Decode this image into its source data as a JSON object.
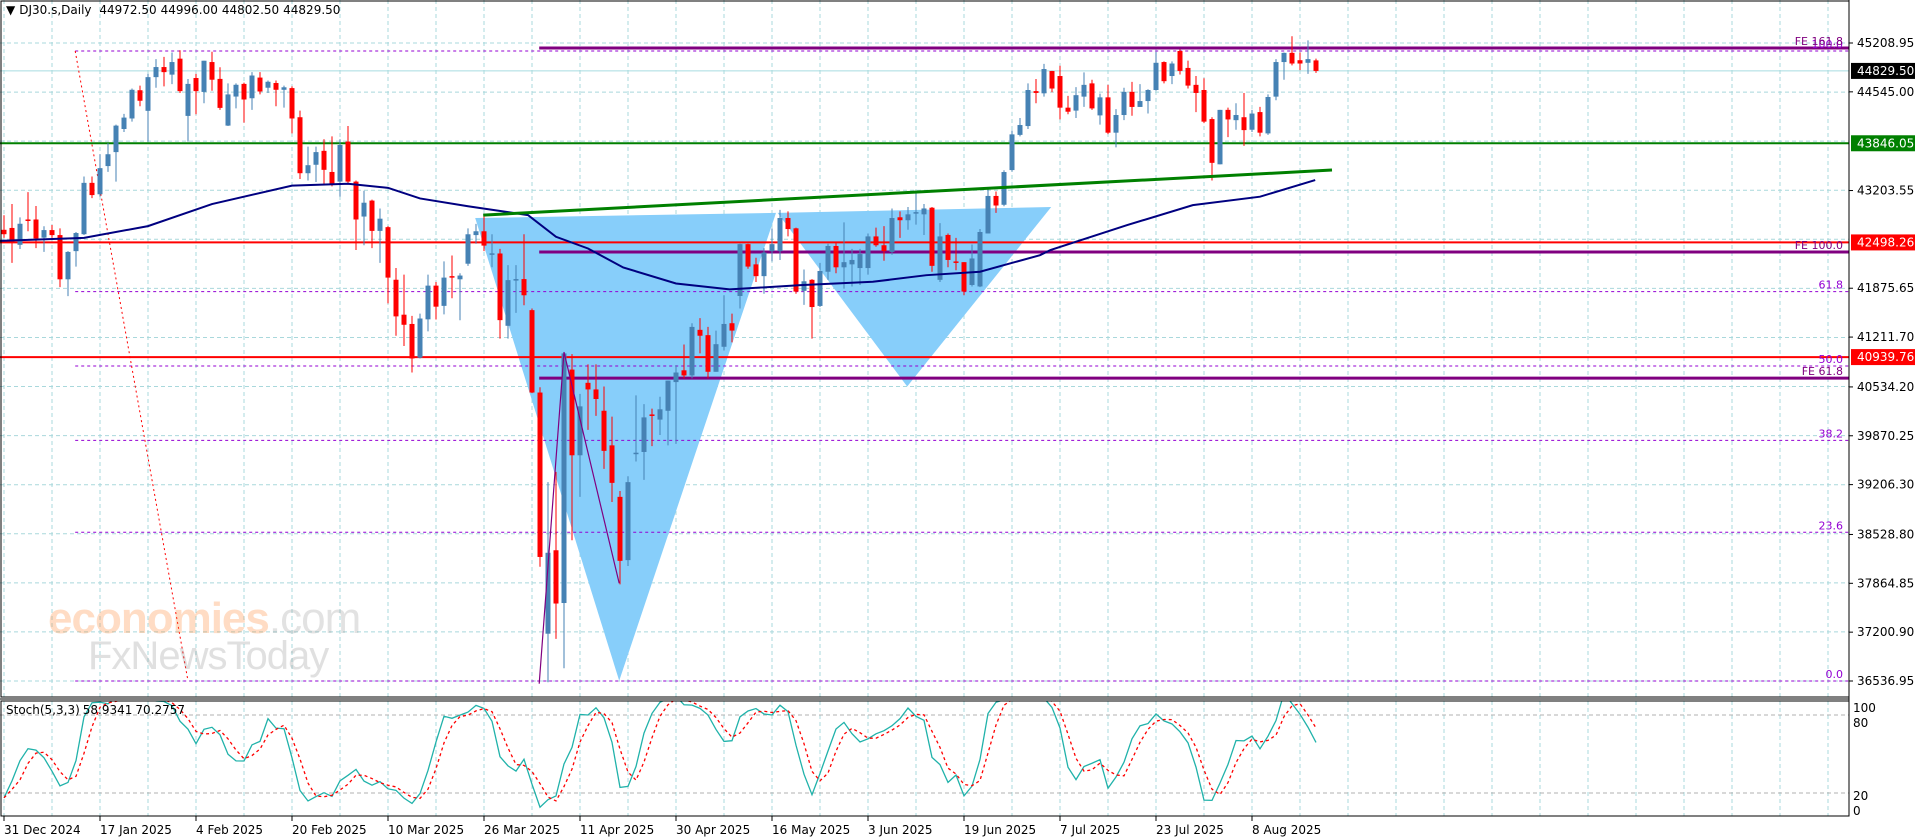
{
  "header": {
    "symbol": "DJ30.s,Daily",
    "open": "44972.50",
    "high": "44996.00",
    "low": "44802.50",
    "close": "44829.50"
  },
  "stoch_header": {
    "name": "Stoch(5,3,3)",
    "main": "58.9341",
    "signal": "70.2757"
  },
  "watermark": {
    "brand1": "economies",
    "brand1_suffix": ".com",
    "brand2": "FxNewsToday"
  },
  "colors": {
    "bull": "#4682B4",
    "bear": "#FF0000",
    "ma": "#000080",
    "grid": "#A9D8DC",
    "triangle": "#87CEFA",
    "fe": "#800080",
    "fib": "#9400D3",
    "trend": "#008000",
    "stoch_main": "#20B2AA",
    "stoch_signal": "#FF0000"
  },
  "chart_data": {
    "type": "candlestick",
    "title": "DJ30.s,Daily",
    "price_axis": {
      "min": 36536.95,
      "max": 45208.95,
      "ticks": [
        "45208.95",
        "44545.00",
        "43203.55",
        "41875.65",
        "41211.70",
        "40534.20",
        "39870.25",
        "39206.30",
        "38528.80",
        "37864.85",
        "37200.90",
        "36536.95"
      ]
    },
    "x_ticks": [
      {
        "label": "31 Dec 2024",
        "index": 0
      },
      {
        "label": "17 Jan 2025",
        "index": 12
      },
      {
        "label": "4 Feb 2025",
        "index": 24
      },
      {
        "label": "20 Feb 2025",
        "index": 36
      },
      {
        "label": "10 Mar 2025",
        "index": 48
      },
      {
        "label": "26 Mar 2025",
        "index": 60
      },
      {
        "label": "11 Apr 2025",
        "index": 72
      },
      {
        "label": "30 Apr 2025",
        "index": 84
      },
      {
        "label": "16 May 2025",
        "index": 96
      },
      {
        "label": "3 Jun 2025",
        "index": 108
      },
      {
        "label": "19 Jun 2025",
        "index": 120
      },
      {
        "label": "7 Jul 2025",
        "index": 132
      },
      {
        "label": "23 Jul 2025",
        "index": 144
      },
      {
        "label": "8 Aug 2025",
        "index": 156
      }
    ],
    "ohlc": [
      [
        42670,
        42867,
        42560,
        42610
      ],
      [
        42695,
        43021,
        42220,
        42495
      ],
      [
        42466,
        42838,
        42409,
        42752
      ],
      [
        42810,
        43182,
        42650,
        42800
      ],
      [
        42810,
        42993,
        42420,
        42552
      ],
      [
        42563,
        42718,
        42370,
        42666
      ],
      [
        42666,
        42735,
        42560,
        42598
      ],
      [
        42598,
        42690,
        41890,
        41997
      ],
      [
        41997,
        42380,
        41768,
        42369
      ],
      [
        42380,
        42640,
        42170,
        42626
      ],
      [
        42610,
        43394,
        42600,
        43308
      ],
      [
        43308,
        43394,
        43100,
        43142
      ],
      [
        43153,
        43697,
        43120,
        43508
      ],
      [
        43536,
        43850,
        43457,
        43697
      ],
      [
        43726,
        44100,
        43325,
        44086
      ],
      [
        44040,
        44245,
        44000,
        44195
      ],
      [
        44183,
        44590,
        44140,
        44573
      ],
      [
        44567,
        44630,
        44350,
        44424
      ],
      [
        44287,
        44790,
        43869,
        44745
      ],
      [
        44745,
        44990,
        44600,
        44882
      ],
      [
        44882,
        45020,
        44620,
        44813
      ],
      [
        44779,
        45080,
        44650,
        44950
      ],
      [
        44996,
        45110,
        44530,
        44555
      ],
      [
        44218,
        44720,
        43869,
        44653
      ],
      [
        44733,
        44790,
        44240,
        44555
      ],
      [
        44544,
        44968,
        44390,
        44968
      ],
      [
        44950,
        45090,
        44560,
        44710
      ],
      [
        44721,
        44880,
        44300,
        44327
      ],
      [
        44086,
        44660,
        44080,
        44510
      ],
      [
        44481,
        44660,
        44320,
        44641
      ],
      [
        44653,
        44670,
        44126,
        44441
      ],
      [
        44458,
        44813,
        44300,
        44767
      ],
      [
        44739,
        44813,
        44510,
        44550
      ],
      [
        44601,
        44700,
        44530,
        44682
      ],
      [
        44665,
        44700,
        44350,
        44573
      ],
      [
        44573,
        44630,
        44330,
        44607
      ],
      [
        44596,
        44620,
        43980,
        44183
      ],
      [
        44200,
        44290,
        43360,
        43439
      ],
      [
        43439,
        43800,
        43340,
        43548
      ],
      [
        43554,
        43800,
        43320,
        43726
      ],
      [
        43743,
        43900,
        43290,
        43485
      ],
      [
        43456,
        43940,
        43260,
        43296
      ],
      [
        43325,
        43900,
        43120,
        43823
      ],
      [
        43869,
        44080,
        43290,
        43325
      ],
      [
        43325,
        43340,
        42396,
        42810
      ],
      [
        42850,
        43200,
        42460,
        43038
      ],
      [
        43067,
        43080,
        42420,
        42655
      ],
      [
        42655,
        42960,
        42220,
        42821
      ],
      [
        42706,
        42720,
        41670,
        42020
      ],
      [
        41991,
        42150,
        41230,
        41493
      ],
      [
        41516,
        42060,
        41090,
        41379
      ],
      [
        41390,
        41500,
        40730,
        40921
      ],
      [
        40932,
        41530,
        40920,
        41464
      ],
      [
        41453,
        42060,
        41290,
        41911
      ],
      [
        41911,
        41960,
        41450,
        41625
      ],
      [
        41636,
        42240,
        41520,
        42020
      ],
      [
        42040,
        42320,
        41740,
        42020
      ],
      [
        41997,
        42080,
        41440,
        42048
      ],
      [
        42209,
        42690,
        42180,
        42609
      ],
      [
        42598,
        42750,
        42480,
        42650
      ],
      [
        42650,
        42870,
        42380,
        42455
      ],
      [
        42340,
        42610,
        42160,
        42350
      ],
      [
        42348,
        42410,
        41190,
        41442
      ],
      [
        41365,
        42190,
        41190,
        41986
      ],
      [
        41990,
        42190,
        41540,
        42000
      ],
      [
        42000,
        42610,
        41645,
        41780
      ],
      [
        41578,
        41600,
        40450,
        40458
      ],
      [
        40458,
        40530,
        38090,
        38223
      ],
      [
        37180,
        39240,
        36520,
        38280
      ],
      [
        38314,
        39380,
        37110,
        37590
      ],
      [
        37597,
        41010,
        36710,
        40990
      ],
      [
        40770,
        40980,
        38450,
        39605
      ],
      [
        39605,
        40440,
        39040,
        40270
      ],
      [
        40590,
        40840,
        39950,
        40500
      ],
      [
        40500,
        40840,
        40140,
        40370
      ],
      [
        40210,
        40540,
        39420,
        39665
      ],
      [
        39740,
        40130,
        38970,
        39230
      ],
      [
        39040,
        39120,
        37850,
        38170
      ],
      [
        38180,
        39320,
        38100,
        39240
      ],
      [
        39630,
        40420,
        39520,
        39640
      ],
      [
        39650,
        40300,
        39270,
        40120
      ],
      [
        40160,
        40240,
        39730,
        40150
      ],
      [
        40090,
        40400,
        39880,
        40230
      ],
      [
        40210,
        40620,
        39740,
        40620
      ],
      [
        40600,
        40830,
        39760,
        40730
      ],
      [
        40760,
        41110,
        40650,
        40690
      ],
      [
        40690,
        41400,
        40650,
        41350
      ],
      [
        41310,
        41470,
        40990,
        41230
      ],
      [
        41238,
        41350,
        40650,
        40740
      ],
      [
        40740,
        41300,
        40740,
        41115
      ],
      [
        41080,
        41780,
        41030,
        41390
      ],
      [
        41400,
        41530,
        41140,
        41300
      ],
      [
        41770,
        42480,
        41600,
        42475
      ],
      [
        42475,
        42480,
        42140,
        42170
      ],
      [
        42200,
        42290,
        41960,
        42040
      ],
      [
        42040,
        42420,
        41800,
        42360
      ],
      [
        42380,
        42690,
        42240,
        42475
      ],
      [
        42380,
        42940,
        42260,
        42830
      ],
      [
        42830,
        42920,
        42580,
        42680
      ],
      [
        42690,
        42700,
        41800,
        41830
      ],
      [
        41840,
        42130,
        41650,
        41970
      ],
      [
        41990,
        42000,
        41190,
        41620
      ],
      [
        41635,
        42220,
        41620,
        42110
      ],
      [
        42100,
        42480,
        41990,
        42450
      ],
      [
        42450,
        42500,
        42080,
        42160
      ],
      [
        42160,
        42770,
        41870,
        42230
      ],
      [
        42200,
        42410,
        41900,
        42260
      ],
      [
        42150,
        42410,
        41920,
        42340
      ],
      [
        42150,
        42620,
        42060,
        42580
      ],
      [
        42580,
        42700,
        42440,
        42460
      ],
      [
        42460,
        42720,
        42250,
        42380
      ],
      [
        42370,
        42960,
        42330,
        42830
      ],
      [
        42840,
        42920,
        42560,
        42800
      ],
      [
        42800,
        42980,
        42670,
        42880
      ],
      [
        42890,
        43190,
        42740,
        42910
      ],
      [
        42880,
        43020,
        42600,
        42960
      ],
      [
        42970,
        42980,
        42100,
        42180
      ],
      [
        41990,
        42760,
        41960,
        42580
      ],
      [
        42600,
        42620,
        42160,
        42260
      ],
      [
        42240,
        42560,
        42120,
        42230
      ],
      [
        42230,
        42230,
        41780,
        41830
      ],
      [
        41920,
        42470,
        41900,
        42280
      ],
      [
        41900,
        42680,
        41890,
        42640
      ],
      [
        42620,
        43240,
        42620,
        43130
      ],
      [
        43130,
        43190,
        42900,
        43000
      ],
      [
        43010,
        43480,
        42990,
        43455
      ],
      [
        43482,
        44020,
        43460,
        43967
      ],
      [
        43960,
        44190,
        43940,
        44094
      ],
      [
        44080,
        44660,
        44040,
        44570
      ],
      [
        44555,
        44720,
        44390,
        44530
      ],
      [
        44525,
        44925,
        44480,
        44855
      ],
      [
        44828,
        44830,
        44540,
        44590
      ],
      [
        44760,
        44900,
        44170,
        44330
      ],
      [
        44330,
        44490,
        44240,
        44275
      ],
      [
        44290,
        44610,
        44190,
        44500
      ],
      [
        44480,
        44810,
        44340,
        44640
      ],
      [
        44660,
        44710,
        44300,
        44320
      ],
      [
        44225,
        44520,
        44100,
        44470
      ],
      [
        44470,
        44640,
        43970,
        43990
      ],
      [
        43990,
        44310,
        43790,
        44230
      ],
      [
        44230,
        44600,
        44160,
        44545
      ],
      [
        44545,
        44680,
        44220,
        44340
      ],
      [
        44340,
        44650,
        44340,
        44420
      ],
      [
        44420,
        44580,
        44250,
        44570
      ],
      [
        44570,
        45090,
        44560,
        44940
      ],
      [
        44950,
        44960,
        44660,
        44690
      ],
      [
        44760,
        44960,
        44650,
        44930
      ],
      [
        45100,
        45120,
        44780,
        44830
      ],
      [
        44870,
        44970,
        44590,
        44630
      ],
      [
        44640,
        44760,
        44270,
        44530
      ],
      [
        44570,
        44730,
        44120,
        44140
      ],
      [
        44175,
        44200,
        43340,
        43580
      ],
      [
        43560,
        44300,
        43560,
        44300
      ],
      [
        44300,
        44330,
        43930,
        44170
      ],
      [
        44160,
        44390,
        44030,
        44230
      ],
      [
        44200,
        44530,
        43810,
        44025
      ],
      [
        44030,
        44300,
        44000,
        44250
      ],
      [
        44270,
        44340,
        43940,
        43990
      ],
      [
        43980,
        44510,
        43960,
        44475
      ],
      [
        44480,
        44990,
        44430,
        44950
      ],
      [
        44950,
        45080,
        44710,
        45075
      ],
      [
        45075,
        45300,
        44905,
        44930
      ],
      [
        44975,
        45080,
        44840,
        44930
      ],
      [
        44940,
        45245,
        44790,
        44990
      ],
      [
        44972.5,
        44996,
        44802.5,
        44829.5
      ]
    ],
    "moving_average": [
      [
        -0.5,
        42520
      ],
      [
        10,
        42560
      ],
      [
        18,
        42720
      ],
      [
        26,
        43020
      ],
      [
        36,
        43270
      ],
      [
        43,
        43295
      ],
      [
        48,
        43240
      ],
      [
        52,
        43096
      ],
      [
        58,
        42990
      ],
      [
        63,
        42910
      ],
      [
        65.5,
        42870
      ],
      [
        69,
        42575
      ],
      [
        73,
        42416
      ],
      [
        77.4,
        42158
      ],
      [
        84,
        41940
      ],
      [
        90.7,
        41860
      ],
      [
        99.6,
        41918
      ],
      [
        108.6,
        41963
      ],
      [
        115.3,
        42053
      ],
      [
        122,
        42100
      ],
      [
        129.5,
        42325
      ],
      [
        130.8,
        42394
      ],
      [
        140.4,
        42734
      ],
      [
        148.6,
        43005
      ],
      [
        157,
        43120
      ],
      [
        163.9,
        43346
      ]
    ],
    "price_lines": [
      {
        "label": "44829.50",
        "value": 44829.5,
        "kind": "current",
        "color": "#000000"
      },
      {
        "label": "43846.05",
        "value": 43846.05,
        "kind": "support",
        "color": "#008000"
      },
      {
        "label": "42498.26",
        "value": 42498.26,
        "kind": "level",
        "color": "#FF0000"
      },
      {
        "label": "40939.76",
        "value": 40939.76,
        "kind": "level",
        "color": "#FF0000"
      }
    ],
    "fib_retracement": {
      "from_index": 8.9,
      "to_index": 23,
      "high": 45100,
      "low": 36536.95,
      "levels": [
        {
          "label": "100.0",
          "value": 45100
        },
        {
          "label": "61.8",
          "value": 41829
        },
        {
          "label": "50.0",
          "value": 40818
        },
        {
          "label": "38.2",
          "value": 39808
        },
        {
          "label": "23.6",
          "value": 38558
        },
        {
          "label": "0.0",
          "value": 36537
        }
      ]
    },
    "fib_expansion": {
      "start_index": 66.9,
      "levels": [
        {
          "label": "FE 161.8",
          "value": 45141
        },
        {
          "label": "FE 100.0",
          "value": 42368
        },
        {
          "label": "FE 61.8",
          "value": 40653
        }
      ]
    },
    "trendline": {
      "from": [
        59.9,
        42870
      ],
      "to": [
        166,
        43482
      ]
    },
    "triangles": [
      [
        [
          58.9,
          42830
        ],
        [
          96.5,
          42900
        ],
        [
          76.9,
          36540
        ]
      ],
      [
        [
          96.7,
          42900
        ],
        [
          130.9,
          42980
        ],
        [
          112.9,
          40540
        ]
      ]
    ],
    "wave": [
      [
        66.9,
        36500
      ],
      [
        70,
        41007
      ],
      [
        76.9,
        37865
      ]
    ],
    "stochastic": {
      "k": 5,
      "d": 3,
      "slowing": 3,
      "levels": [
        80,
        20
      ],
      "axis_labels": [
        "100",
        "80",
        "20",
        "0"
      ]
    }
  }
}
